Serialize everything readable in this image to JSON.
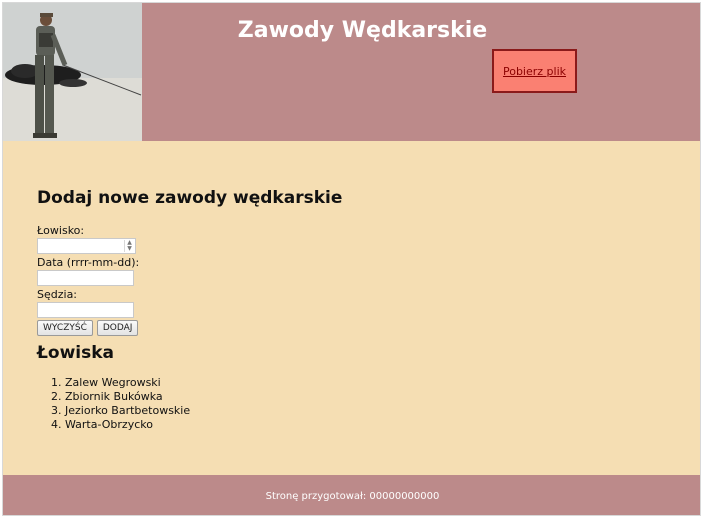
{
  "header": {
    "title": "Zawody Wędkarskie",
    "download_label": "Pobierz plik",
    "image_icon": "angler-photo"
  },
  "form": {
    "heading": "Dodaj nowe zawody wędkarskie",
    "fishery_label": "Łowisko:",
    "fishery_value": "",
    "date_label": "Data (rrrr-mm-dd):",
    "date_value": "",
    "judge_label": "Sędzia:",
    "judge_value": "",
    "clear_button": "WYCZYŚĆ",
    "add_button": "DODAJ"
  },
  "fisheries": {
    "heading": "Łowiska",
    "items": [
      "1. Zalew Wegrowski",
      "2. Zbiornik Bukówka",
      "3. Jeziorko Bartbetowskie",
      "4. Warta-Obrzycko"
    ]
  },
  "footer": {
    "text": "Stronę przygotował: 00000000000"
  },
  "colors": {
    "header_bg": "#bc8a8a",
    "main_bg": "#f5deb3",
    "download_bg": "#fa8072",
    "download_border": "#8b1a1a"
  }
}
